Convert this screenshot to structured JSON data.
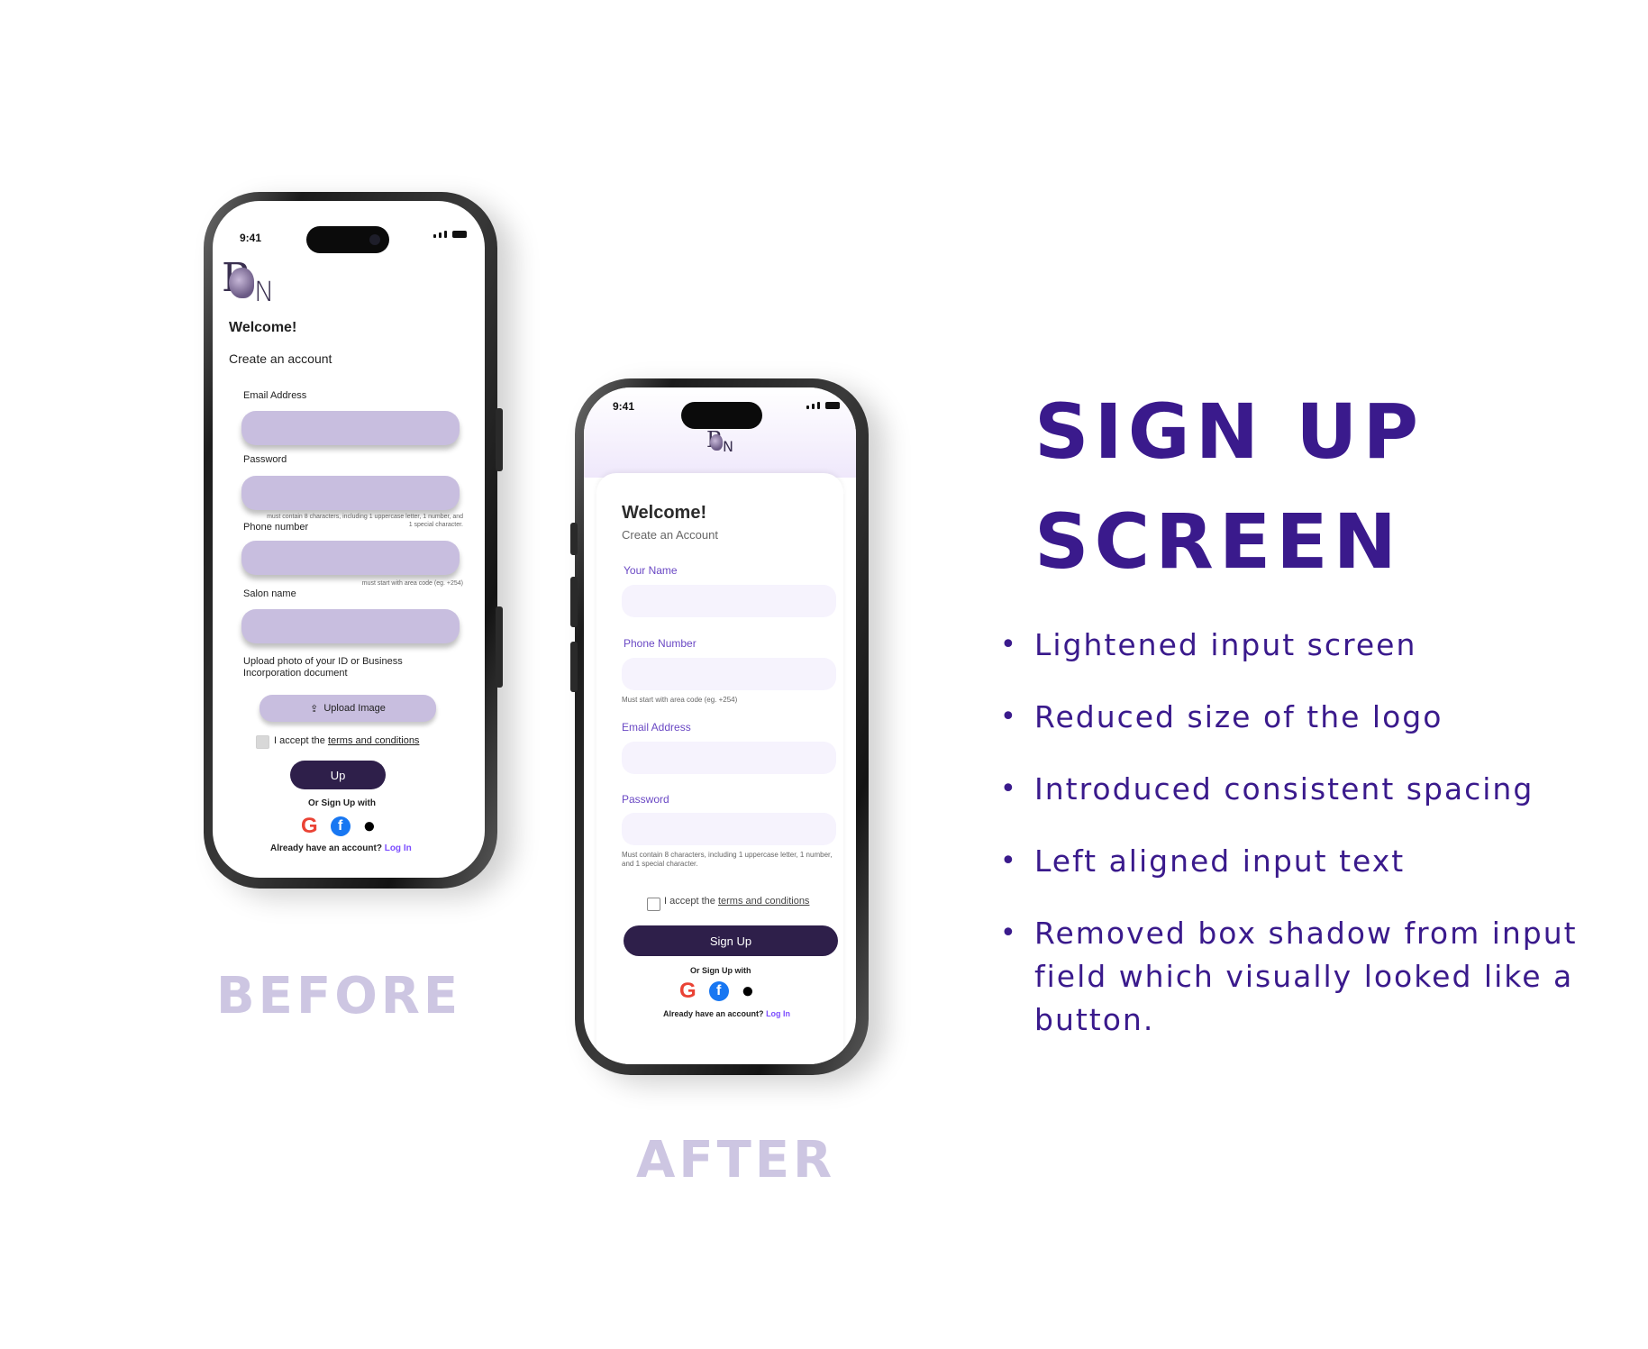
{
  "before_phone": {
    "time": "9:41",
    "logo_letters": {
      "b": "B",
      "n": "N"
    },
    "welcome": "Welcome!",
    "subtitle": "Create an account",
    "fields": [
      {
        "label": "Email Address"
      },
      {
        "label": "Password",
        "hint": "must contain 8 characters, including 1 uppercase letter, 1 number, and 1 special character."
      },
      {
        "label": "Phone number",
        "hint": "must start with area code (eg. +254)"
      },
      {
        "label": "Salon name"
      }
    ],
    "upload_label": "Upload photo of your ID or Business Incorporation document",
    "upload_button": "Upload Image",
    "terms_prefix": "I accept the",
    "terms_link": "terms and conditions",
    "submit_button": "Up",
    "or_sign_up": "Or Sign Up with",
    "have_account": "Already have an account?",
    "login_link": "Log In"
  },
  "after_phone": {
    "time": "9:41",
    "logo_letters": {
      "b": "B",
      "n": "N"
    },
    "welcome": "Welcome!",
    "subtitle": "Create an Account",
    "fields": [
      {
        "label": "Your Name"
      },
      {
        "label": "Phone Number",
        "hint": "Must start with area code (eg. +254)"
      },
      {
        "label": "Email Address"
      },
      {
        "label": "Password",
        "hint": "Must contain 8 characters, including 1 uppercase letter, 1 number, and 1 special character."
      }
    ],
    "terms_prefix": "I accept the",
    "terms_link": "terms and conditions",
    "submit_button": "Sign Up",
    "or_sign_up": "Or Sign Up with",
    "have_account": "Already have an account?",
    "login_link": "Log In"
  },
  "captions": {
    "before": "BEFORE",
    "after": "AFTER"
  },
  "heading": {
    "line1": "SIGN UP",
    "line2": "SCREEN"
  },
  "bullets": [
    "Lightened input screen",
    "Reduced size of the logo",
    "Introduced consistent spacing",
    "Left aligned input text",
    "Removed box shadow from input field which visually looked like a button."
  ],
  "colors": {
    "heading": "#3a1a8c",
    "caption": "#cdc6e2",
    "before_input": "#c8bedf",
    "after_input": "#f6f3fd",
    "button": "#2e1f4a",
    "link": "#7c4dff"
  },
  "icons": [
    "google-icon",
    "facebook-icon",
    "apple-icon",
    "upload-icon",
    "signal-icon",
    "wifi-icon",
    "battery-icon"
  ]
}
